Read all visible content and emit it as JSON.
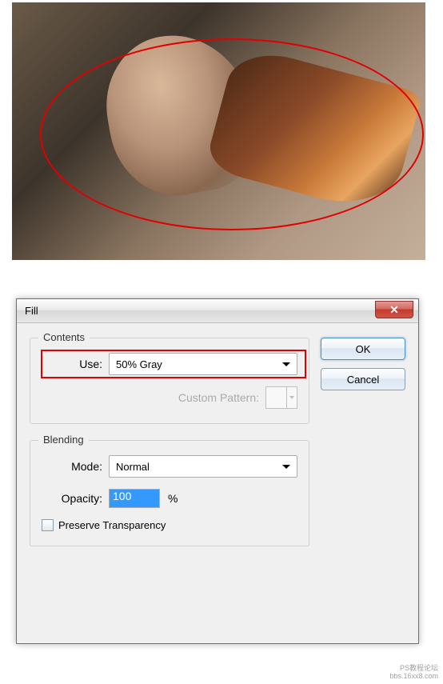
{
  "top_image": {
    "annotation": "red-ellipse"
  },
  "dialog": {
    "title": "Fill",
    "contents": {
      "legend": "Contents",
      "use_label": "Use:",
      "use_value": "50% Gray",
      "custom_pattern_label": "Custom Pattern:"
    },
    "blending": {
      "legend": "Blending",
      "mode_label": "Mode:",
      "mode_value": "Normal",
      "opacity_label": "Opacity:",
      "opacity_value": "100",
      "opacity_unit": "%",
      "preserve_label": "Preserve Transparency"
    },
    "buttons": {
      "ok": "OK",
      "cancel": "Cancel"
    }
  },
  "watermark": {
    "line1": "PS教程论坛",
    "line2": "bbs.16xx8.com"
  }
}
